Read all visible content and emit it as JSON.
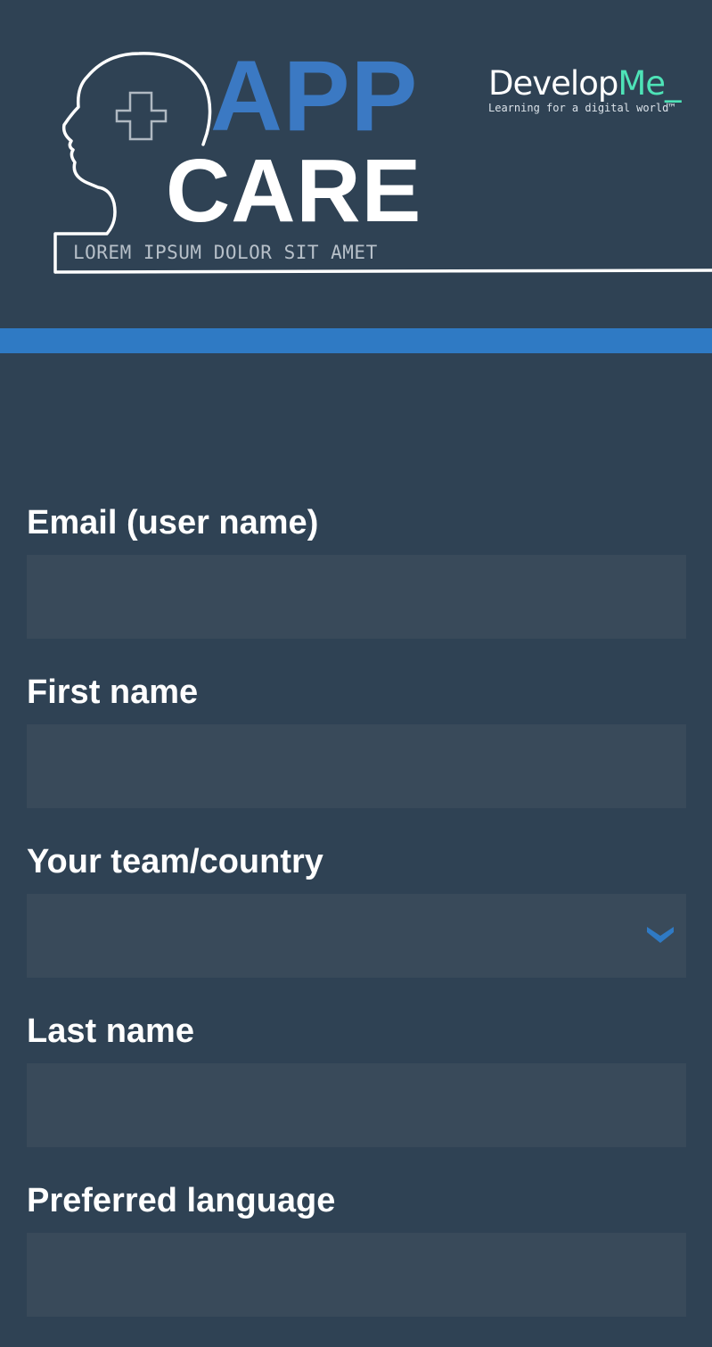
{
  "header": {
    "app_word": "APP",
    "care_word": "CARE",
    "tagline": "LOREM IPSUM DOLOR SIT AMET",
    "brand": {
      "name_part1": "Develop",
      "name_part2": "Me_",
      "tagline": "Learning for a digital world™"
    }
  },
  "form": {
    "email_label": "Email (user name)",
    "email_value": "",
    "first_name_label": "First name",
    "first_name_value": "",
    "team_label": "Your team/country",
    "team_value": "",
    "last_name_label": "Last name",
    "last_name_value": "",
    "language_label": "Preferred language",
    "language_value": ""
  },
  "colors": {
    "background": "#2f4254",
    "accent_blue": "#2f7ac4",
    "app_blue": "#3b79c3",
    "input_bg": "#394a5a",
    "brand_accent": "#4ee3b7"
  },
  "icons": [
    "head-outline-icon",
    "medical-cross-icon",
    "chevron-down-icon"
  ]
}
